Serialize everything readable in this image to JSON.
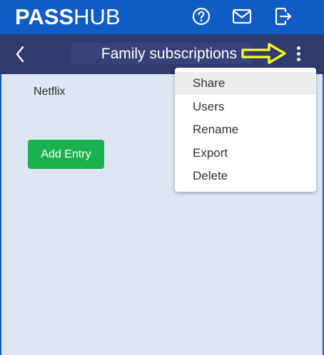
{
  "app": {
    "logo_bold": "PASS",
    "logo_light": "HUB",
    "brand_color": "#0f5cc7",
    "subbar_color": "#2f3b6e"
  },
  "header": {
    "icons": [
      "help-icon",
      "mail-icon",
      "logout-icon"
    ]
  },
  "folder": {
    "title": "Family subscriptions"
  },
  "entries": [
    {
      "name": "Netflix"
    }
  ],
  "actions": {
    "add_entry_label": "Add Entry",
    "add_entry_color": "#19b24f"
  },
  "menu": {
    "items": [
      {
        "label": "Share",
        "highlighted": true
      },
      {
        "label": "Users"
      },
      {
        "label": "Rename"
      },
      {
        "label": "Export"
      },
      {
        "label": "Delete"
      }
    ]
  },
  "annotation": {
    "arrow_color": "#f5f51c"
  }
}
